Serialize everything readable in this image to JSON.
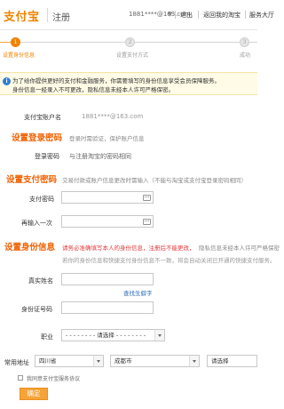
{
  "header": {
    "logo": "支付宝",
    "subtitle": "注册",
    "account": "1881****@163.com",
    "nav": [
      "退出",
      "返回我的淘宝",
      "服务大厅"
    ]
  },
  "steps": [
    {
      "num": "1",
      "label": "设置身份信息",
      "state": "active"
    },
    {
      "num": "2",
      "label": "设置支付方式",
      "state": "inactive"
    },
    {
      "num": "3",
      "label": "成功",
      "state": "inactive"
    }
  ],
  "notice": {
    "icon": "i",
    "line1": "为了给你提供更好的支付和金融服务，你需要填写的身份信息享受会员保障服务。",
    "line2": "身份信息一经录入不可更改，隐私信息未经本人许可严格保密。"
  },
  "account_row": {
    "label": "支付宝账户名",
    "value": "1881****@163.com"
  },
  "login_pw": {
    "title": "设置登录密码",
    "desc": "登录时需验证，保护账户信息",
    "label": "登录密码",
    "value": "与注册淘宝的密码相同"
  },
  "pay_pw": {
    "title": "设置支付密码",
    "desc": "交易付款或账户信息更改时需输入（不能与淘宝或支付宝登录密码相同）",
    "field1_label": "支付密码",
    "field2_label": "再输入一次"
  },
  "identity": {
    "title": "设置身份信息",
    "desc_red": "请务必准确填写本人的身份信息，注册后不能更改，",
    "desc_rest": "隐私信息未经本人许可严格保密",
    "hint": "若你的身份信息和快捷支付身份信息不一致，将会自动关闭已开通的快捷支付服务。",
    "name_label": "真实姓名",
    "rare_char_link": "查找生僻字",
    "id_label": "身份证号码",
    "job_label": "职业",
    "job_value": "- - - - - - - - 请选择 - - - - - - - -",
    "address_label": "常用地址",
    "province": "四川省",
    "city": "成都市",
    "district": "请选择"
  },
  "agreement": "我同意支付宝服务协议",
  "confirm_label": "确定"
}
